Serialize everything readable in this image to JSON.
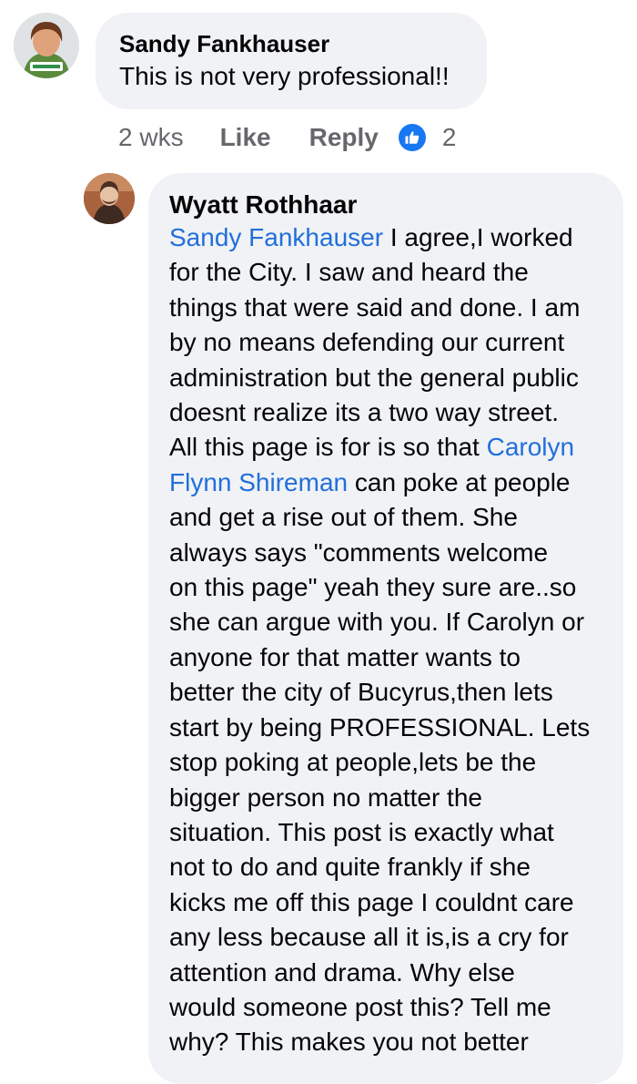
{
  "first_comment": {
    "author": "Sandy Fankhauser",
    "text": "This is not very professional!!",
    "time": "2 wks",
    "like_label": "Like",
    "reply_label": "Reply",
    "reaction_icon": "thumbs-up-icon",
    "reaction_count": "2"
  },
  "reply_comment": {
    "author": "Wyatt Rothhaar",
    "mention_1": "Sandy Fankhauser",
    "text_1": " I agree,I worked\nfor the City. I saw and heard the\nthings that were said and done. I am\nby no means defending our current\nadministration but the general public\ndoesnt realize its a two way street.\nAll this page is for is so that ",
    "mention_2": "Carolyn\nFlynn Shireman",
    "text_2": " can poke at people\nand get a rise out of them. She\nalways says \"comments welcome\non this page\" yeah they sure are..so\nshe can argue with you. If Carolyn or\nanyone for that matter wants to\nbetter the city of Bucyrus,then lets\nstart by being PROFESSIONAL. Lets\nstop poking at people,lets be the\nbigger person no matter the\nsituation. This post is exactly what\nnot to do and quite frankly if she\nkicks me off this page I couldnt care\nany less because all it is,is a cry for\nattention and drama. Why else\nwould someone post this? Tell me\nwhy? This makes you not better"
  },
  "colors": {
    "bubble": "#f0f2f5",
    "mention": "#216fdb",
    "meta_text": "#65676b",
    "like_reaction": "#1877f2"
  }
}
